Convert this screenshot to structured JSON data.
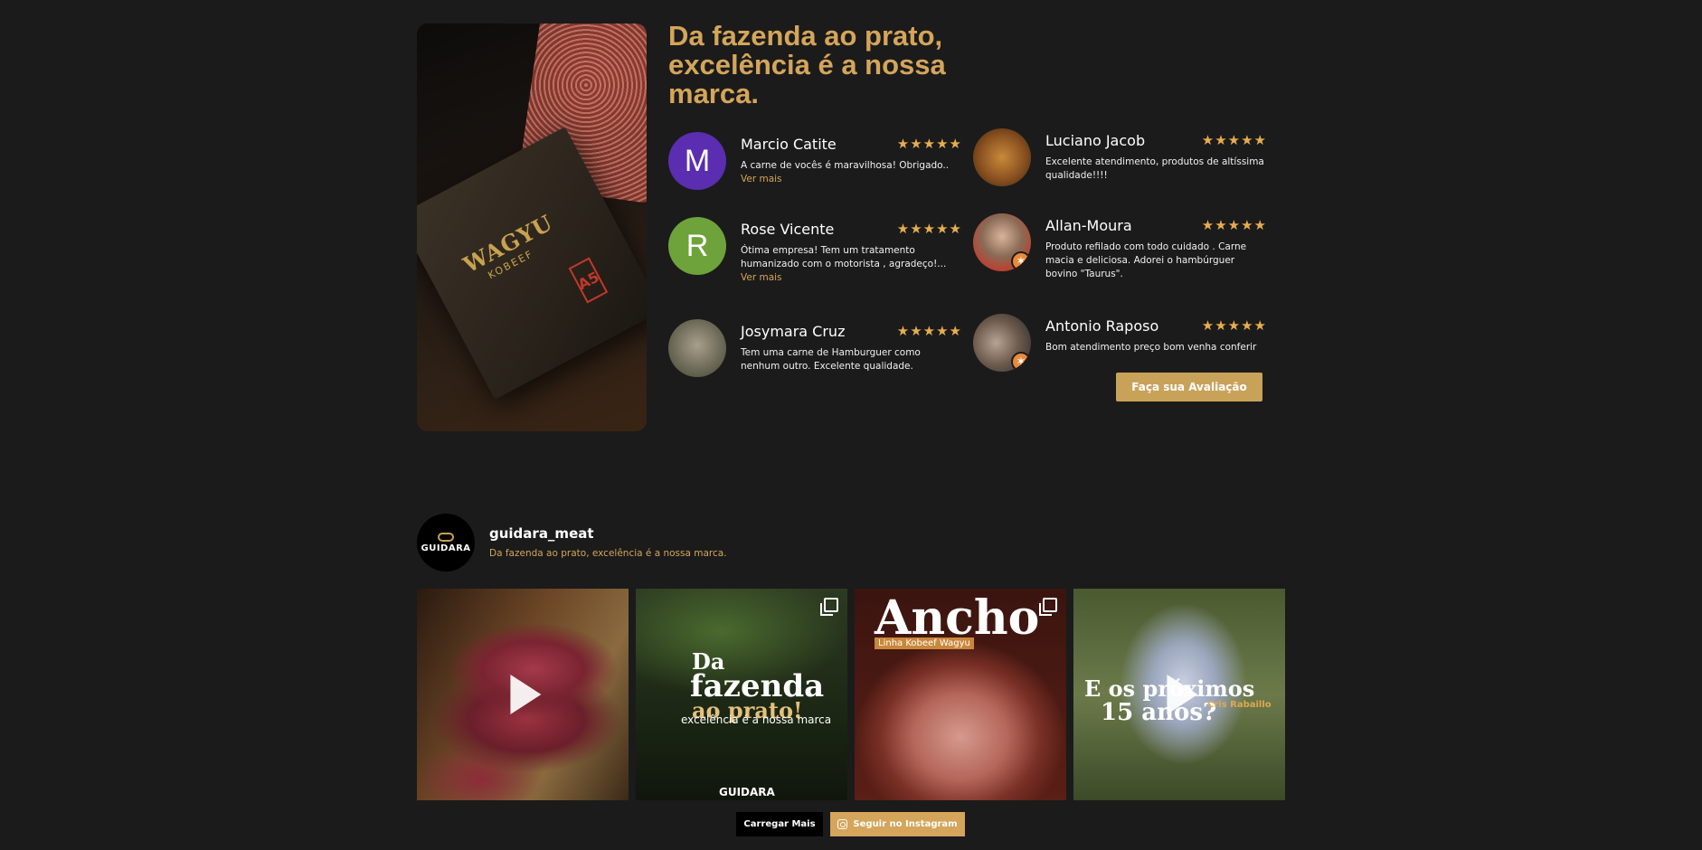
{
  "hero": {
    "brand": "WAGYU",
    "brand_sub": "KOBEEF",
    "grade": "A5"
  },
  "reviews_section": {
    "headline": "Da fazenda ao prato, excelência é a nossa marca.",
    "stars": "★★★★★",
    "reviews": [
      {
        "name": "Marcio Catite",
        "initial": "M",
        "avatar_color": "#5b2db0",
        "text": "A carne de vocês é maravilhosa! Obrigado..",
        "more": "Ver mais"
      },
      {
        "name": "Rose Vicente",
        "initial": "R",
        "avatar_color": "#6ea33b",
        "text": "Ótima empresa! Tem um tratamento humanizado com o motorista , agradeço!...",
        "more": "Ver mais"
      },
      {
        "name": "Josymara Cruz",
        "initial": "",
        "avatar_color": "#9a9a8a",
        "text": "Tem uma carne de Hamburguer como nenhum outro. Excelente qualidade.",
        "more": ""
      },
      {
        "name": "Luciano Jacob",
        "initial": "",
        "avatar_color": "#8a5a2a",
        "text": "Excelente atendimento, produtos de altíssima qualidade!!!!",
        "more": ""
      },
      {
        "name": "Allan-Moura",
        "initial": "",
        "avatar_color": "#7a6a5a",
        "text": "Produto refilado com todo cuidado . Carne macia e deliciosa. Adorei o hambúrguer bovino \"Taurus\".",
        "more": ""
      },
      {
        "name": "Antonio Raposo",
        "initial": "",
        "avatar_color": "#6a6a6a",
        "text": "Bom atendimento preço bom venha conferir",
        "more": ""
      }
    ],
    "cta_label": "Faça sua Avaliação"
  },
  "instagram": {
    "handle": "guidara_meat",
    "bio": "Da fazenda ao prato, excelência é a nossa marca.",
    "avatar_text": "GUIDARA",
    "posts": [
      {
        "type": "video"
      },
      {
        "type": "carousel",
        "title_a": "Da",
        "title_b": "fazenda",
        "title_c": "ao prato!",
        "subtitle": "excelência é a nossa marca",
        "brand": "GUIDARA"
      },
      {
        "type": "carousel",
        "title": "Ancho",
        "tag": "Linha Kobeef Wagyu"
      },
      {
        "type": "video",
        "title_a": "E os próximos",
        "title_b": "15 anos?",
        "person": "Cris Rabaillo"
      }
    ],
    "load_more_label": "Carregar Mais",
    "follow_label": "Seguir no Instagram"
  }
}
